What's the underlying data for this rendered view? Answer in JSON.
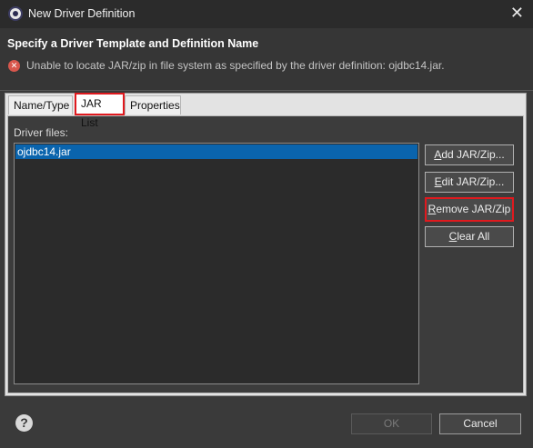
{
  "window": {
    "title": "New Driver Definition",
    "close_glyph": "✕"
  },
  "banner": {
    "title": "Specify a Driver Template and Definition Name",
    "error_message": "Unable to locate JAR/zip in file system as specified by the driver definition: ojdbc14.jar.",
    "error_icon": "error-icon"
  },
  "tabs": [
    {
      "label": "Name/Type",
      "selected": false
    },
    {
      "label": "JAR List",
      "selected": true
    },
    {
      "label": "Properties",
      "selected": false
    }
  ],
  "jar_list": {
    "label": "Driver files:",
    "files": [
      "ojdbc14.jar"
    ],
    "selected_index": 0
  },
  "buttons": {
    "add": {
      "mnemonic": "A",
      "rest": "dd JAR/Zip..."
    },
    "edit": {
      "mnemonic": "E",
      "rest": "dit JAR/Zip..."
    },
    "remove": {
      "mnemonic": "R",
      "rest": "emove JAR/Zip"
    },
    "clear": {
      "mnemonic": "C",
      "rest": "lear All"
    }
  },
  "footer": {
    "help_glyph": "?",
    "ok_label": "OK",
    "cancel_label": "Cancel"
  },
  "colors": {
    "highlight": "#e0191e",
    "selection": "#0a64ad"
  }
}
